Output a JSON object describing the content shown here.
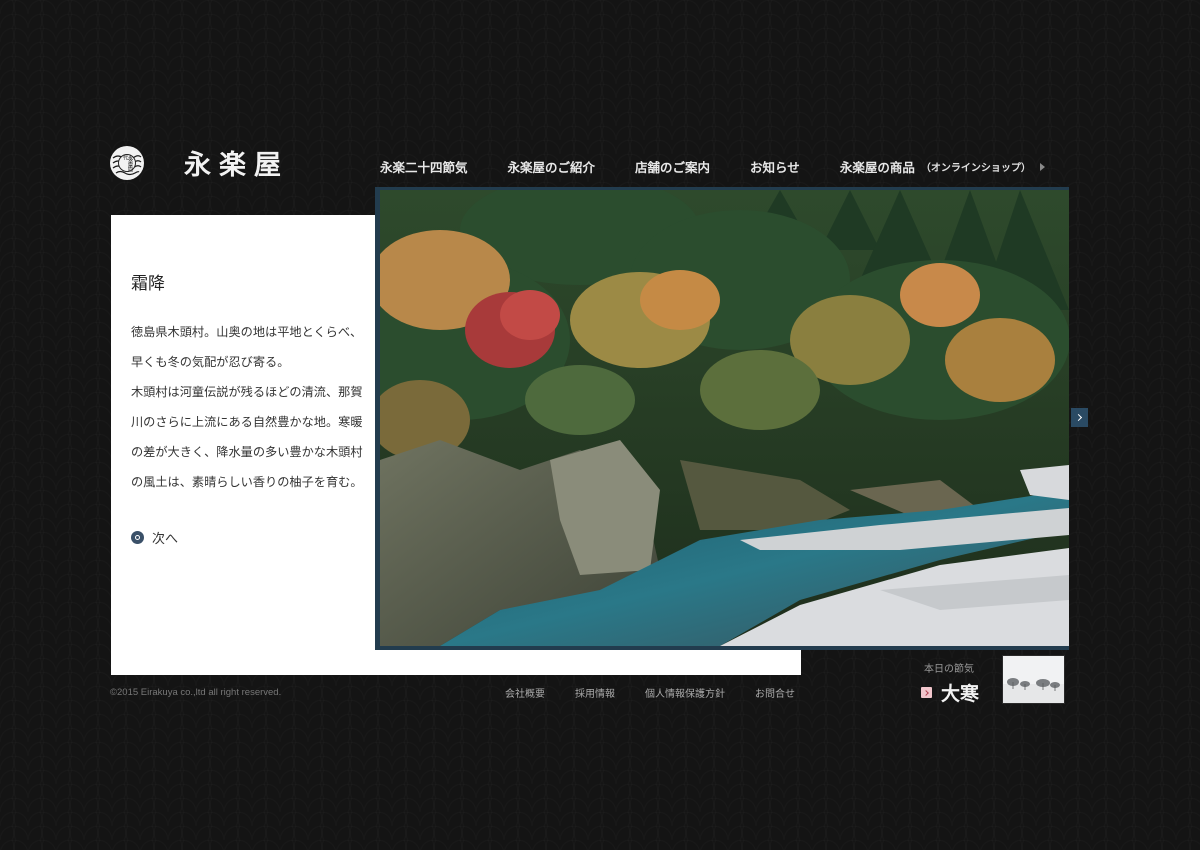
{
  "brand": {
    "name": "永楽屋",
    "seal_text": "永楽屋四代"
  },
  "nav": {
    "items": [
      "永楽二十四節気",
      "永楽屋のご紹介",
      "店舗のご案内",
      "お知らせ"
    ],
    "shop_label": "永楽屋の商品",
    "shop_sub": "（オンラインショップ）"
  },
  "article": {
    "title": "霜降",
    "lines": [
      "徳島県木頭村。山奥の地は平地とくらべ、",
      "早くも冬の気配が忍び寄る。",
      "木頭村は河童伝説が残るほどの清流、那賀",
      "川のさらに上流にある自然豊かな地。寒暖",
      "の差が大きく、降水量の多い豊かな木頭村",
      "の風土は、素晴らしい香りの柚子を育む。"
    ],
    "next_label": "次へ"
  },
  "footer": {
    "copyright": "©2015 Eirakuya co.,ltd all right reserved.",
    "links": [
      "会社概要",
      "採用情報",
      "個人情報保護方針",
      "お問合せ"
    ]
  },
  "today": {
    "label": "本日の節気",
    "name": "大寒"
  },
  "colors": {
    "background": "#141414",
    "panel": "#ffffff",
    "accent_navy": "#2a4a63",
    "accent_pink": "#f1c6cc"
  },
  "icons": {
    "next": "circle-dot-icon",
    "slider": "chevron-right-icon",
    "today": "chevron-right-icon",
    "nav_shop": "triangle-right-icon"
  }
}
